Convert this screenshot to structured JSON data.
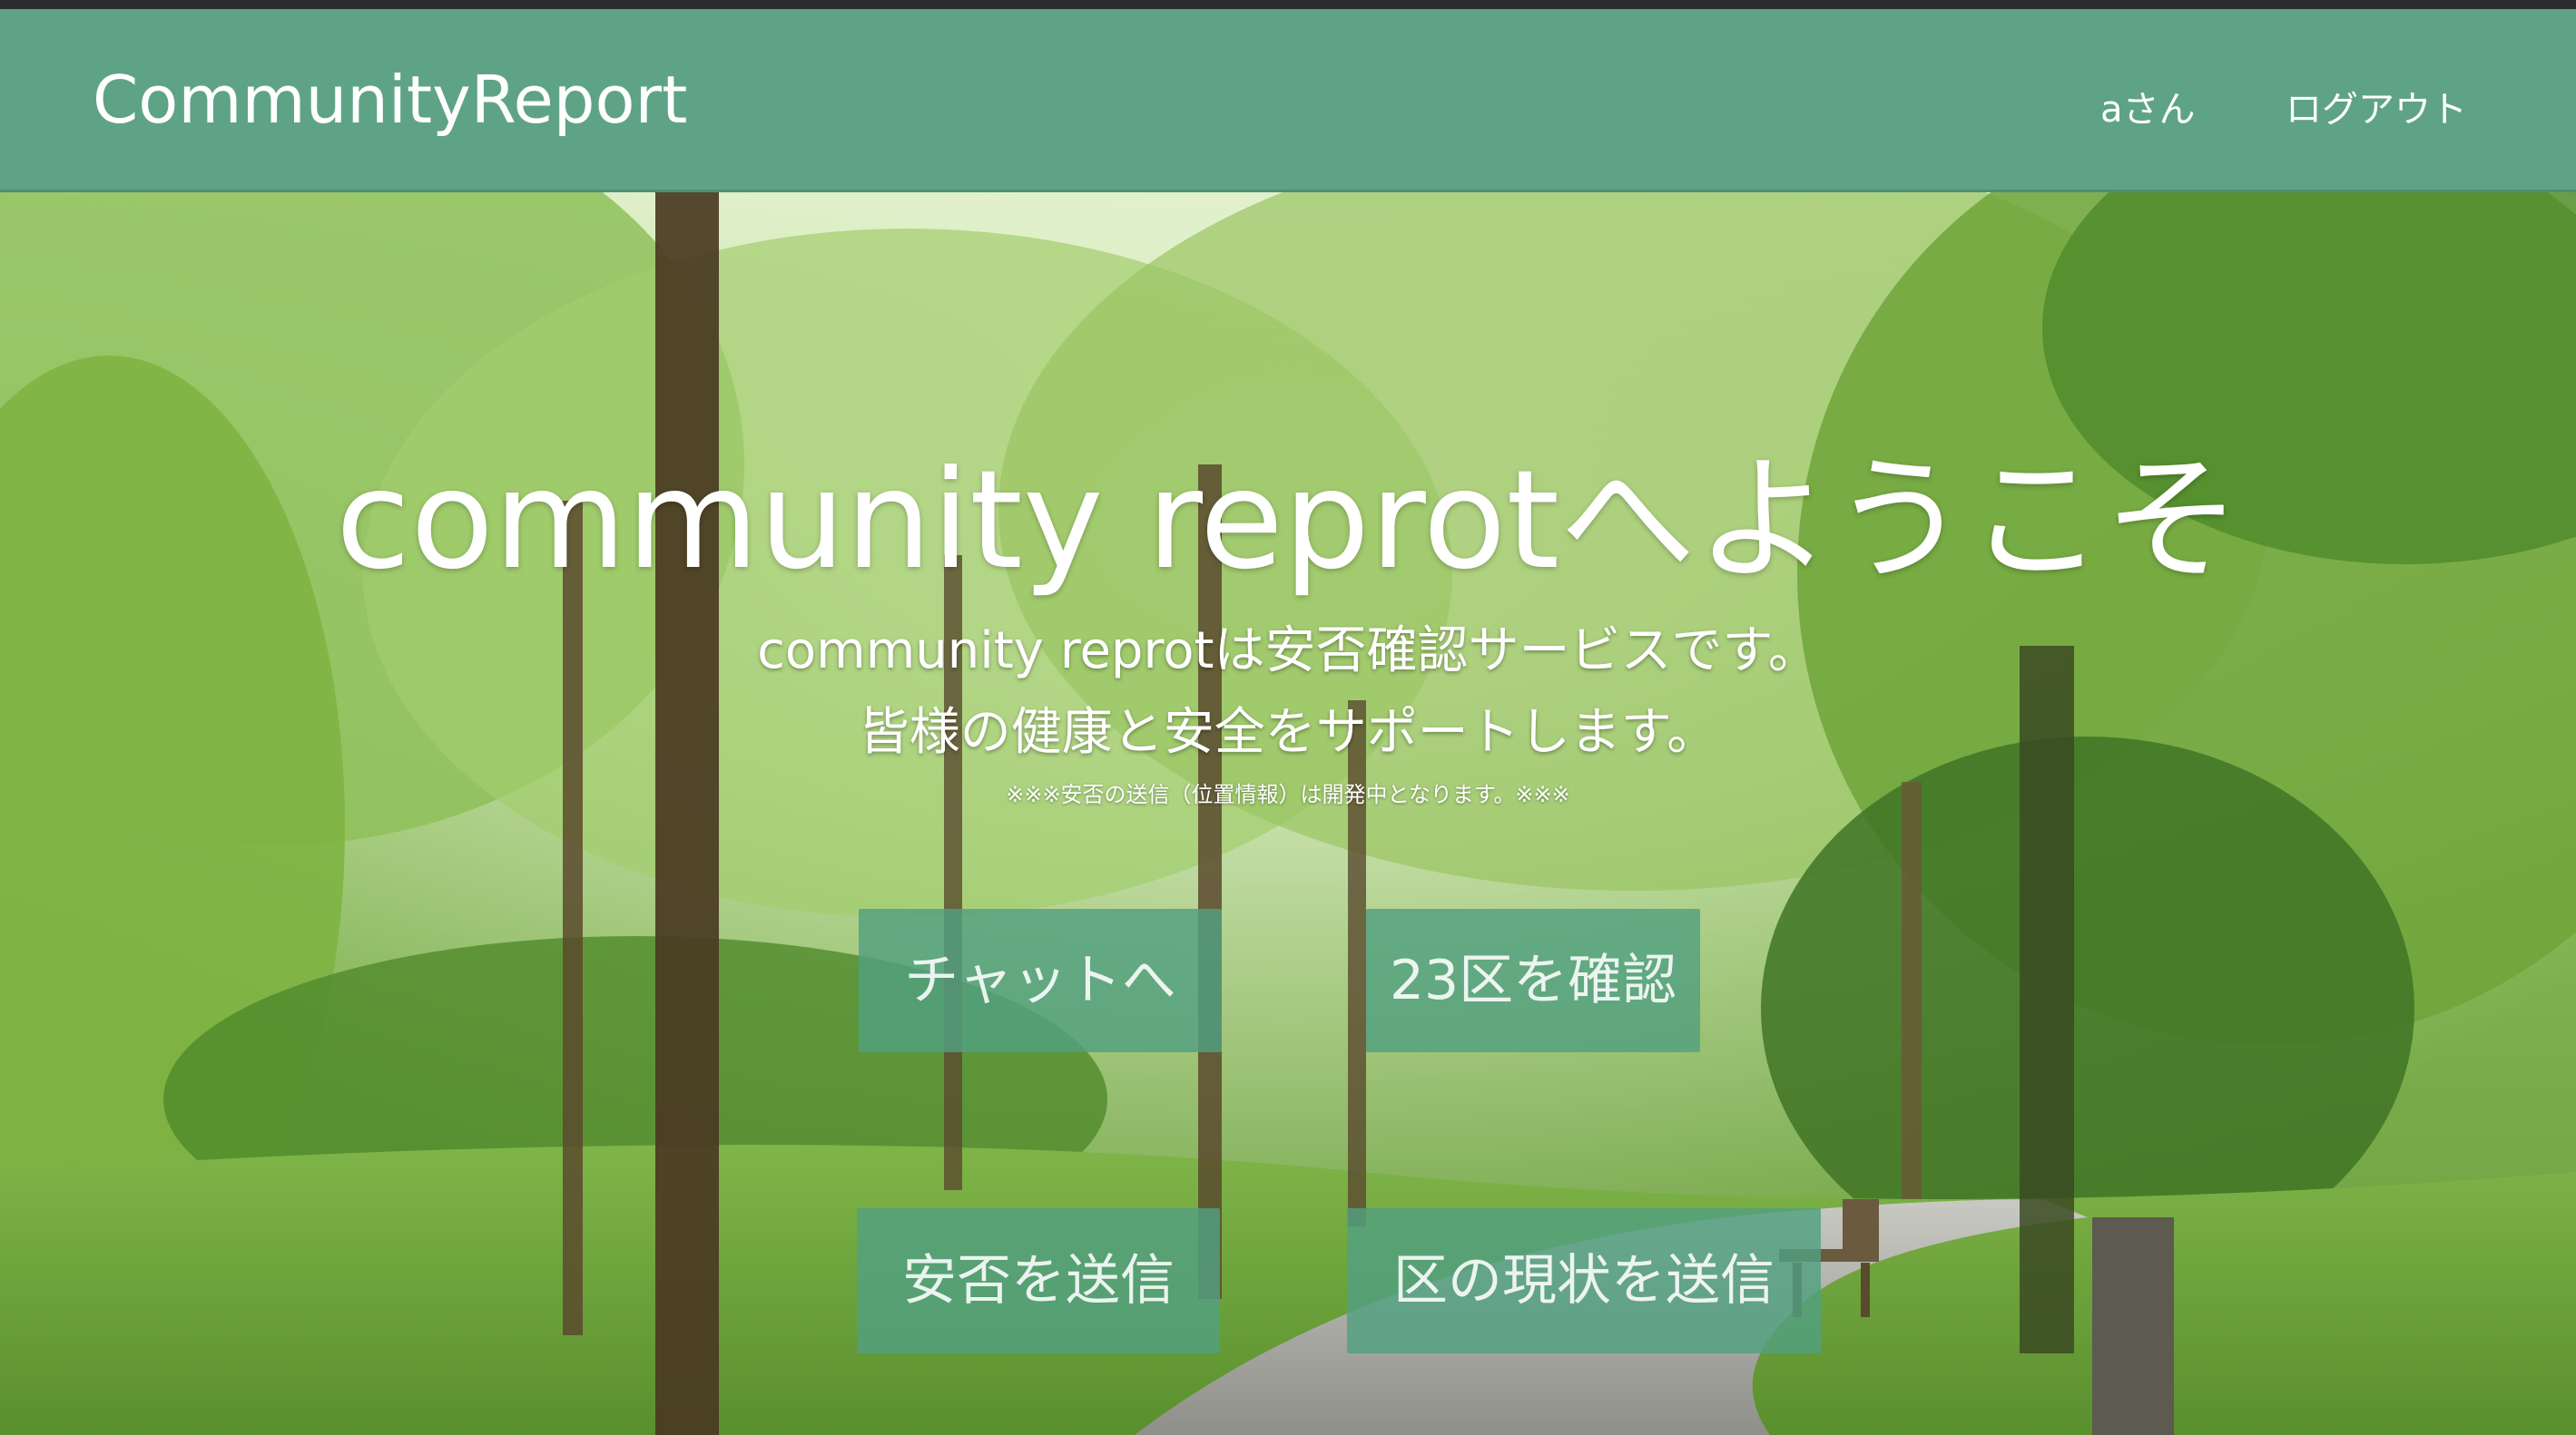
{
  "navbar": {
    "brand": "CommunityReport",
    "user": "aさん",
    "logout": "ログアウト"
  },
  "hero": {
    "title": "community reprotへようこそ",
    "subtitle_line1": "community reprotは安否確認サービスです。",
    "subtitle_line2": "皆様の健康と安全をサポートします。",
    "note": "※※※安否の送信（位置情報）は開発中となります。※※※"
  },
  "actions": {
    "chat": "チャットへ",
    "check_wards": "23区を確認",
    "send_safety": "安否を送信",
    "send_ward_status": "区の現状を送信"
  },
  "colors": {
    "navbar": "#5fa387",
    "button": "#52a080",
    "text": "#ffffff"
  }
}
